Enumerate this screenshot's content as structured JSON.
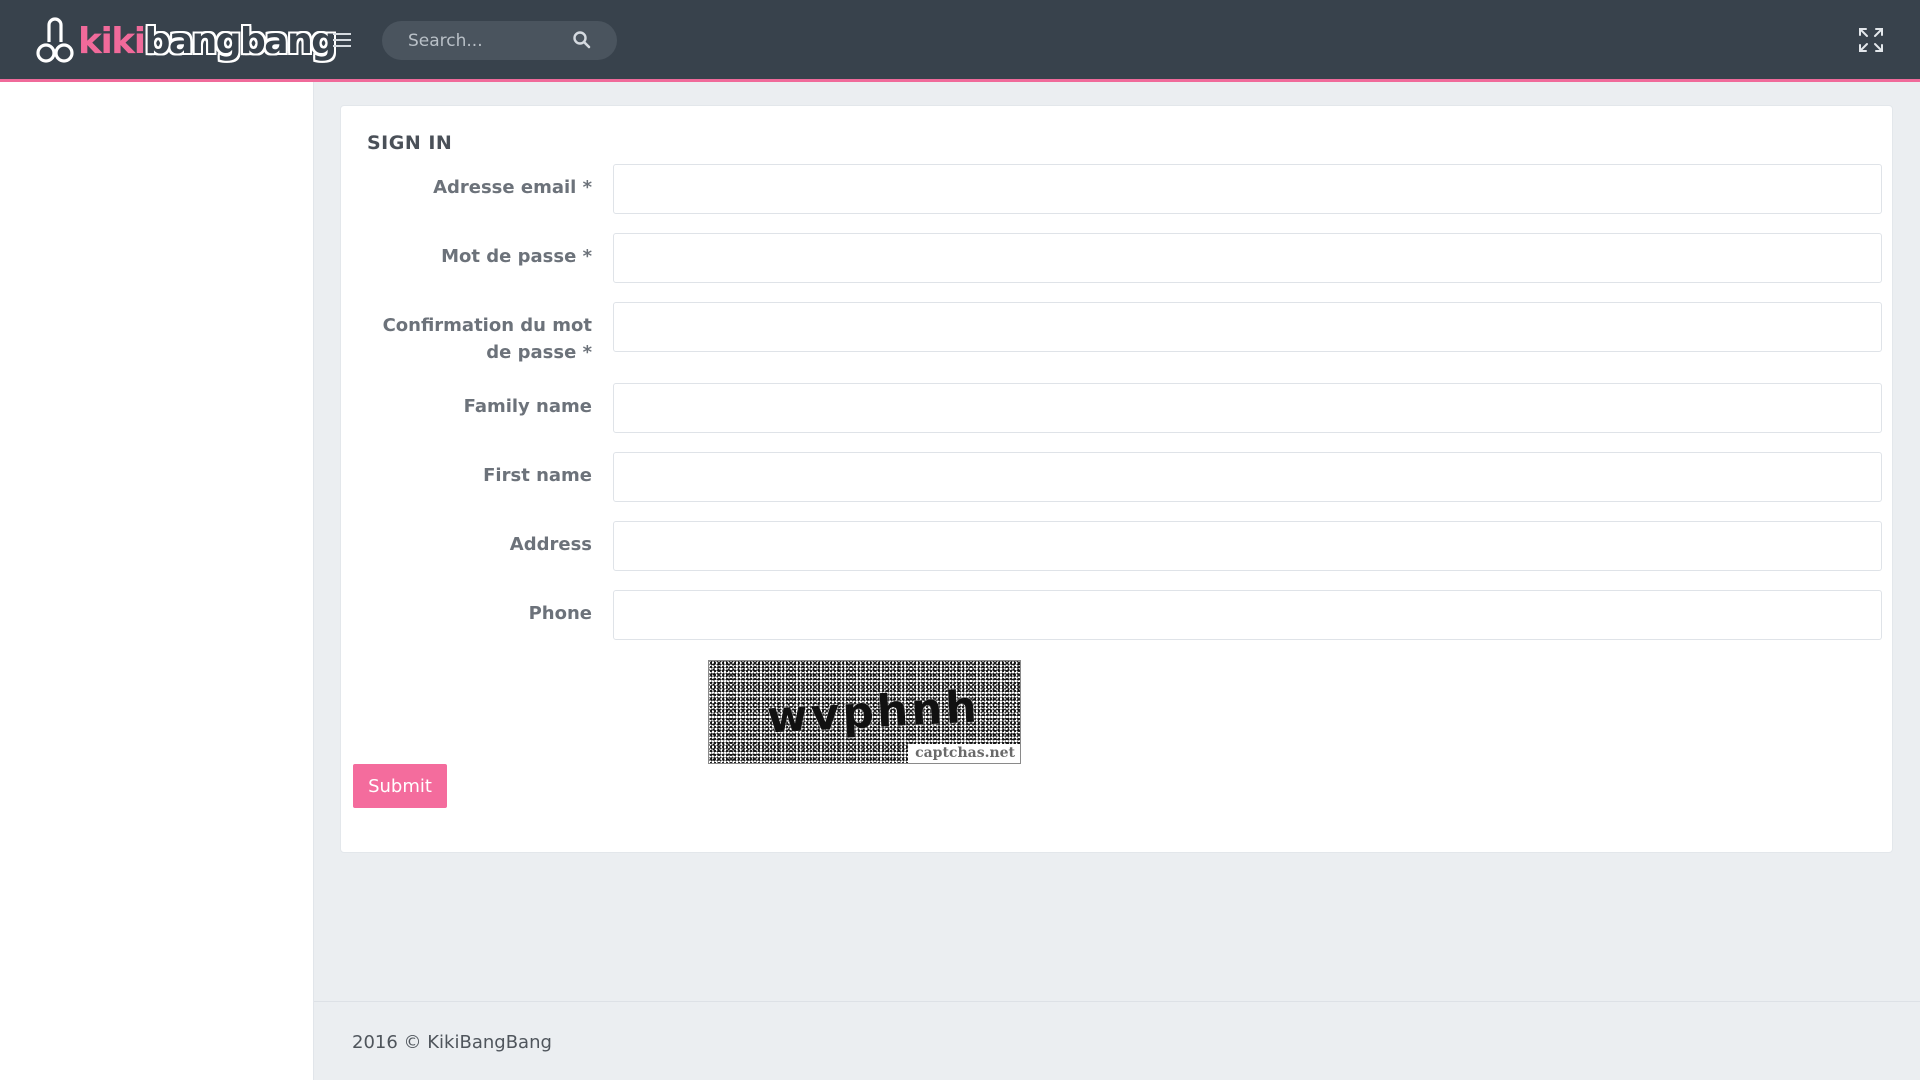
{
  "brand": {
    "part1": "kiki",
    "part2": "bangbang",
    "accent_color": "#f06a9a",
    "header_color": "#38424c"
  },
  "header": {
    "menu_icon": "hamburger-icon",
    "search": {
      "placeholder": "Search...",
      "value": "",
      "icon": "search-icon"
    },
    "fullscreen_icon": "expand-icon"
  },
  "form": {
    "title": "SIGN IN",
    "fields": [
      {
        "label": "Adresse email *",
        "value": "",
        "type": "email"
      },
      {
        "label": "Mot de passe *",
        "value": "",
        "type": "password"
      },
      {
        "label": "Confirmation du mot de passe *",
        "value": "",
        "type": "password"
      },
      {
        "label": "Family name",
        "value": "",
        "type": "text"
      },
      {
        "label": "First name",
        "value": "",
        "type": "text"
      },
      {
        "label": "Address",
        "value": "",
        "type": "text"
      },
      {
        "label": "Phone",
        "value": "",
        "type": "text"
      }
    ],
    "captcha": {
      "word": "wvphnh",
      "brand": "captchas.net"
    },
    "submit_label": "Submit",
    "submit_color": "#f46c9d"
  },
  "footer": {
    "text": "2016 © KikiBangBang"
  }
}
